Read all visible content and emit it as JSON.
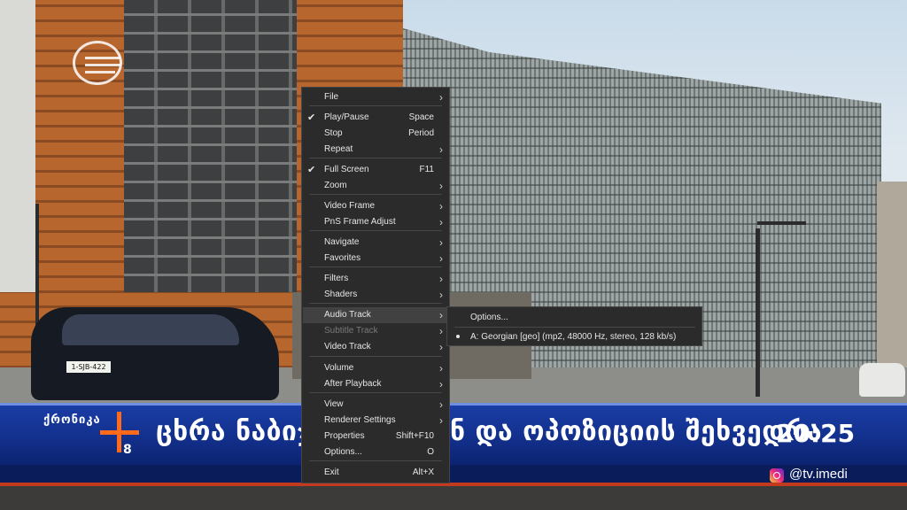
{
  "video": {
    "car_plate": "1-SJB-422",
    "ticker": {
      "program_name": "ქრონიკა",
      "program_number": "8",
      "headline_left": "ცხრა ნაბიჯი",
      "headline_right": "ნ და ოპოზიციის შეხვედრა",
      "clock": "20:25",
      "social_handle": "@tv.imedi"
    }
  },
  "context_menu": {
    "items": [
      {
        "label": "File",
        "shortcut": "",
        "checked": false,
        "submenu": true,
        "disabled": false
      },
      {
        "label": "Play/Pause",
        "shortcut": "Space",
        "checked": true,
        "submenu": false,
        "disabled": false
      },
      {
        "label": "Stop",
        "shortcut": "Period",
        "checked": false,
        "submenu": false,
        "disabled": false
      },
      {
        "label": "Repeat",
        "shortcut": "",
        "checked": false,
        "submenu": true,
        "disabled": false
      },
      {
        "label": "Full Screen",
        "shortcut": "F11",
        "checked": true,
        "submenu": false,
        "disabled": false
      },
      {
        "label": "Zoom",
        "shortcut": "",
        "checked": false,
        "submenu": true,
        "disabled": false
      },
      {
        "label": "Video Frame",
        "shortcut": "",
        "checked": false,
        "submenu": true,
        "disabled": false
      },
      {
        "label": "PnS Frame Adjust",
        "shortcut": "",
        "checked": false,
        "submenu": true,
        "disabled": false
      },
      {
        "label": "Navigate",
        "shortcut": "",
        "checked": false,
        "submenu": true,
        "disabled": false
      },
      {
        "label": "Favorites",
        "shortcut": "",
        "checked": false,
        "submenu": true,
        "disabled": false
      },
      {
        "label": "Filters",
        "shortcut": "",
        "checked": false,
        "submenu": true,
        "disabled": false
      },
      {
        "label": "Shaders",
        "shortcut": "",
        "checked": false,
        "submenu": true,
        "disabled": false
      },
      {
        "label": "Audio Track",
        "shortcut": "",
        "checked": false,
        "submenu": true,
        "disabled": false,
        "highlighted": true
      },
      {
        "label": "Subtitle Track",
        "shortcut": "",
        "checked": false,
        "submenu": true,
        "disabled": true
      },
      {
        "label": "Video Track",
        "shortcut": "",
        "checked": false,
        "submenu": true,
        "disabled": false
      },
      {
        "label": "Volume",
        "shortcut": "",
        "checked": false,
        "submenu": true,
        "disabled": false
      },
      {
        "label": "After Playback",
        "shortcut": "",
        "checked": false,
        "submenu": true,
        "disabled": false
      },
      {
        "label": "View",
        "shortcut": "",
        "checked": false,
        "submenu": true,
        "disabled": false
      },
      {
        "label": "Renderer Settings",
        "shortcut": "",
        "checked": false,
        "submenu": true,
        "disabled": false
      },
      {
        "label": "Properties",
        "shortcut": "Shift+F10",
        "checked": false,
        "submenu": false,
        "disabled": false
      },
      {
        "label": "Options...",
        "shortcut": "O",
        "checked": false,
        "submenu": false,
        "disabled": false
      },
      {
        "label": "Exit",
        "shortcut": "Alt+X",
        "checked": false,
        "submenu": false,
        "disabled": false
      }
    ],
    "check_glyph": "✔",
    "arrow_glyph": "›"
  },
  "audio_submenu": {
    "items": [
      {
        "label": "Options...",
        "selected": false
      },
      {
        "label": "A: Georgian [geo] (mp2, 48000 Hz, stereo, 128 kb/s)",
        "selected": true
      }
    ]
  }
}
